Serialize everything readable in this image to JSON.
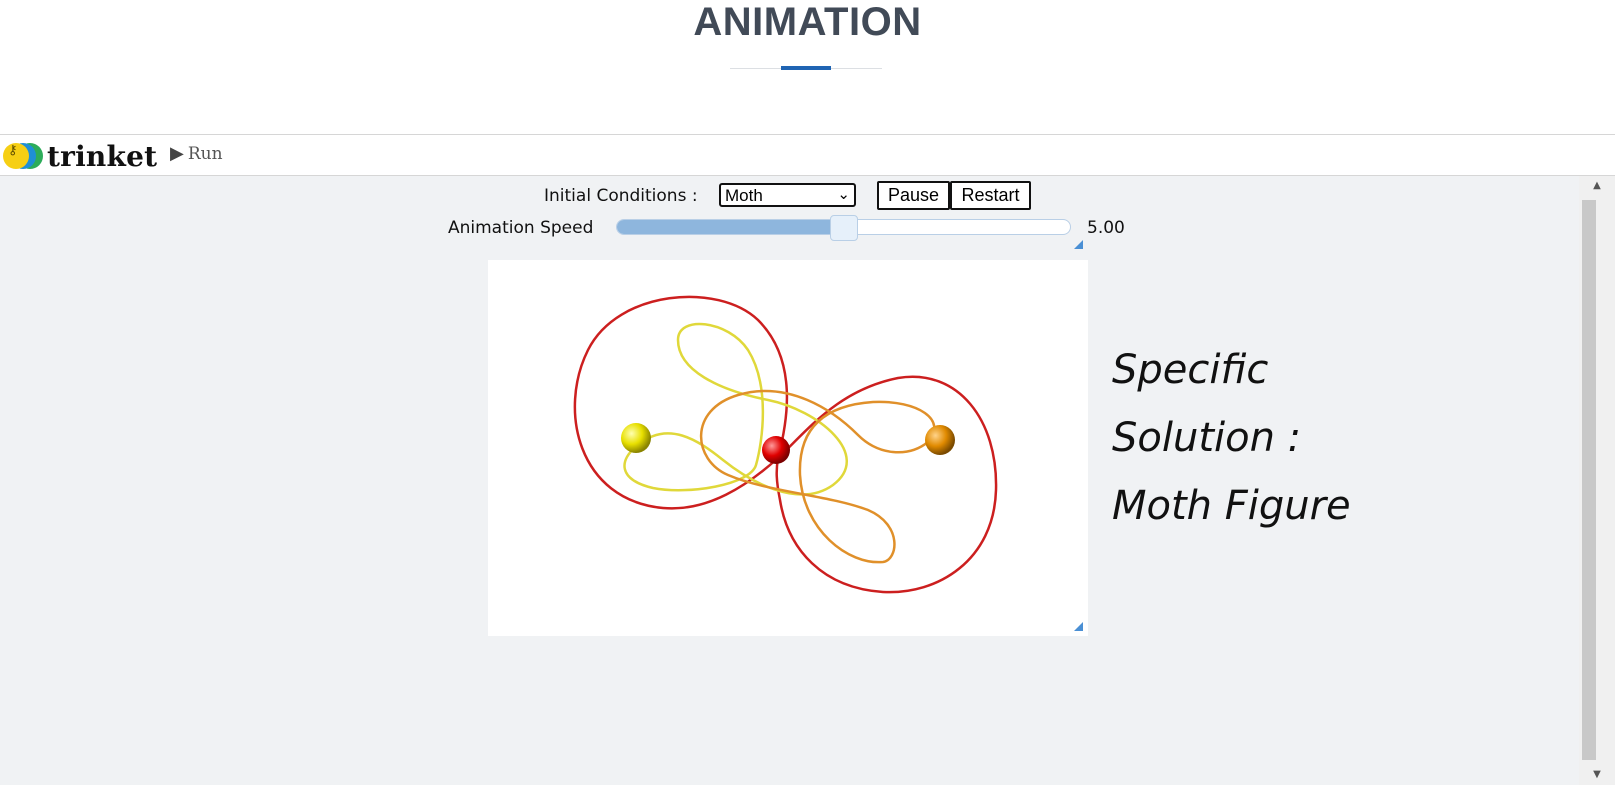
{
  "header": {
    "title": "ANIMATION"
  },
  "trinket": {
    "logo_text": "trinket",
    "run_label": "Run"
  },
  "controls": {
    "initial_conditions_label": "Initial Conditions :",
    "initial_conditions_value": "Moth",
    "pause_label": "Pause",
    "restart_label": "Restart",
    "speed_label": "Animation Speed",
    "speed_value": "5.00",
    "speed_fraction": 0.5
  },
  "caption": {
    "line1": "Specific",
    "line2": "Solution :",
    "line3": "Moth Figure"
  },
  "colors": {
    "accent": "#1f64b3",
    "orbit_red": "#cc1f1f",
    "orbit_yellow": "#e0d83a",
    "orbit_orange": "#e0902a"
  },
  "icons": [
    "trinket-logo-icon",
    "run-triangle-icon",
    "chevron-down-icon",
    "resize-grip-icon",
    "scroll-up-icon",
    "scroll-down-icon"
  ]
}
